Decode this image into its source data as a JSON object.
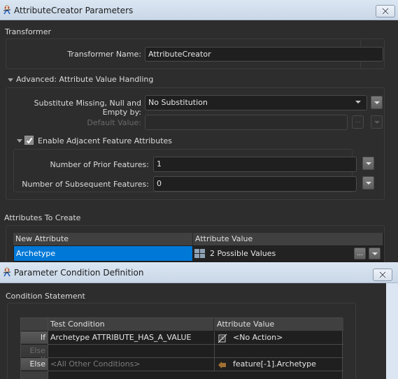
{
  "window1": {
    "title": "AttributeCreator Parameters",
    "close_icon": "close-x-icon",
    "app_icon": "fme-wizard-icon",
    "transformer_section": {
      "label": "Transformer",
      "name_label": "Transformer Name:",
      "name_value": "AttributeCreator"
    },
    "advanced_section": {
      "label": "Advanced: Attribute Value Handling",
      "expanded": true,
      "substitute_label": "Substitute Missing, Null and Empty by:",
      "substitute_value": "No Substitution",
      "default_value_label": "Default Value:",
      "default_value": "",
      "default_value_ellipsis": "...",
      "adjacent": {
        "label": "Enable Adjacent Feature Attributes",
        "checked": true,
        "prior_label": "Number of Prior Features:",
        "prior_value": "1",
        "subsequent_label": "Number of Subsequent Features:",
        "subsequent_value": "0"
      }
    },
    "attributes_section": {
      "label": "Attributes To Create",
      "columns": [
        "New Attribute",
        "Attribute Value"
      ],
      "rows": [
        {
          "new_attribute": "Archetype",
          "attribute_value": "2 Possible Values",
          "value_icon": "conditional-grid-icon",
          "selected": true,
          "ellipsis": "..."
        }
      ]
    },
    "colors": {
      "selection": "#0078d7",
      "background": "#2d2d2d",
      "titlebar": "#d3dfed"
    }
  },
  "window2": {
    "title": "Parameter Condition Definition",
    "close_icon": "close-x-icon",
    "app_icon": "fme-wizard-icon",
    "section_label": "Condition Statement",
    "columns": [
      "Test Condition",
      "Attribute Value"
    ],
    "rows": [
      {
        "row_label": "If",
        "test_condition": "Archetype ATTRIBUTE_HAS_A_VALUE",
        "attribute_value": "<No Action>",
        "value_icon": "no-action-icon"
      },
      {
        "row_label": "Else If",
        "test_condition": "",
        "attribute_value": ""
      },
      {
        "row_label": "Else",
        "test_condition": "<All Other Conditions>",
        "attribute_value": "feature[-1].Archetype",
        "value_icon": "attribute-arrow-icon"
      }
    ]
  }
}
